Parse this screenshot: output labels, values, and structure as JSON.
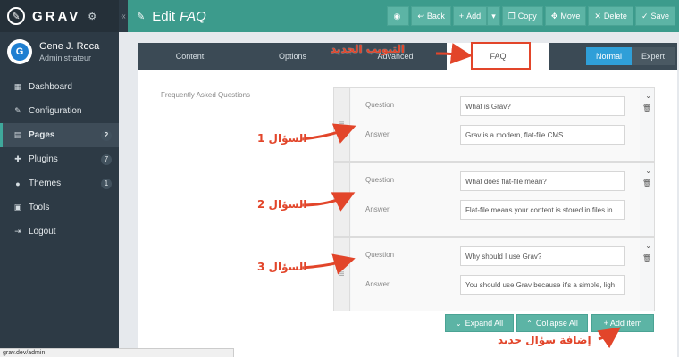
{
  "brand": {
    "name": "GRAV"
  },
  "user": {
    "name": "Gene J. Roca",
    "role": "Administrateur",
    "avatar_letter": "G"
  },
  "nav": [
    {
      "label": "Dashboard",
      "icon": "dashboard-icon",
      "glyph": "▦",
      "badge": ""
    },
    {
      "label": "Configuration",
      "icon": "wrench-icon",
      "glyph": "✎",
      "badge": ""
    },
    {
      "label": "Pages",
      "icon": "file-icon",
      "glyph": "▤",
      "badge": "2",
      "active": true
    },
    {
      "label": "Plugins",
      "icon": "plug-icon",
      "glyph": "✚",
      "badge": "7"
    },
    {
      "label": "Themes",
      "icon": "drop-icon",
      "glyph": "●",
      "badge": "1"
    },
    {
      "label": "Tools",
      "icon": "briefcase-icon",
      "glyph": "▣",
      "badge": ""
    },
    {
      "label": "Logout",
      "icon": "logout-icon",
      "glyph": "⇥",
      "badge": ""
    }
  ],
  "header": {
    "title_prefix": "Edit",
    "title_emph": "FAQ"
  },
  "toolbar": {
    "back": "Back",
    "add": "Add",
    "copy": "Copy",
    "move": "Move",
    "delete": "Delete",
    "save": "Save"
  },
  "tabs": [
    "Content",
    "Options",
    "Advanced",
    "FAQ"
  ],
  "modes": {
    "normal": "Normal",
    "expert": "Expert"
  },
  "section_label": "Frequently Asked Questions",
  "field_labels": {
    "question": "Question",
    "answer": "Answer"
  },
  "faqs": [
    {
      "question": "What is Grav?",
      "answer": "Grav is a modern, flat-file CMS."
    },
    {
      "question": "What does flat-file mean?",
      "answer": "Flat-file means your content is stored in files in"
    },
    {
      "question": "Why should I use Grav?",
      "answer": "You should use Grav because it's a simple, ligh"
    }
  ],
  "buttons": {
    "expand": "Expand All",
    "collapse": "Collapse All",
    "add_item": "+ Add item"
  },
  "annotations": {
    "new_tab": "التبويب الجديد",
    "q1": "السؤال 1",
    "q2": "السؤال 2",
    "q3": "السؤال 3",
    "add_new": "إضافة سؤال جديد"
  },
  "status_url": "grav.dev/admin",
  "colors": {
    "accent": "#3c9b8c",
    "sidebar": "#2d3a45",
    "annotation": "#e2452a",
    "mode_active": "#2f9fd8"
  }
}
